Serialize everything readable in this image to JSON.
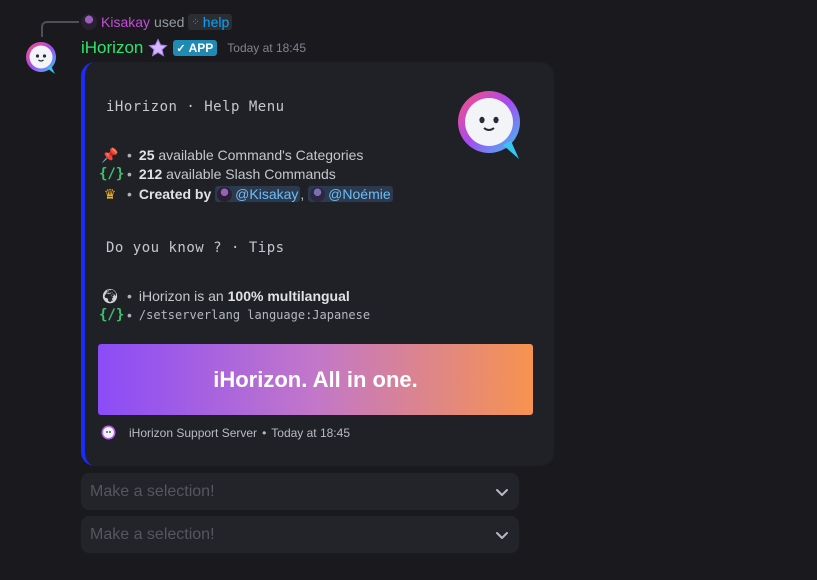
{
  "reply": {
    "user": "Kisakay",
    "used_text": "used",
    "command": "help"
  },
  "message": {
    "bot_name": "iHorizon",
    "badge": "APP",
    "timestamp": "Today at 18:45"
  },
  "embed": {
    "accent_color": "#1d2cf5",
    "title": "iHorizon  ·  Help Menu",
    "stats": [
      {
        "icon": "pushpin-icon",
        "number": "25",
        "text": "available Command's Categories"
      },
      {
        "icon": "braces-icon",
        "number": "212",
        "text": "available Slash Commands"
      }
    ],
    "created_by_label": "Created by",
    "creators": [
      "@Kisakay",
      "@Noémie"
    ],
    "creators_separator": ",",
    "tips_title": "Do you know ?  ·  Tips",
    "tip_prefix": "iHorizon is an",
    "tip_bold": "100% multilangual",
    "tip_command": "/setserverlang language:Japanese",
    "banner_text": "iHorizon. All in one.",
    "footer_text": "iHorizon Support Server",
    "footer_time": "Today at 18:45",
    "bullet": "•"
  },
  "selects": [
    {
      "placeholder": "Make a selection!"
    },
    {
      "placeholder": "Make a selection!"
    }
  ]
}
